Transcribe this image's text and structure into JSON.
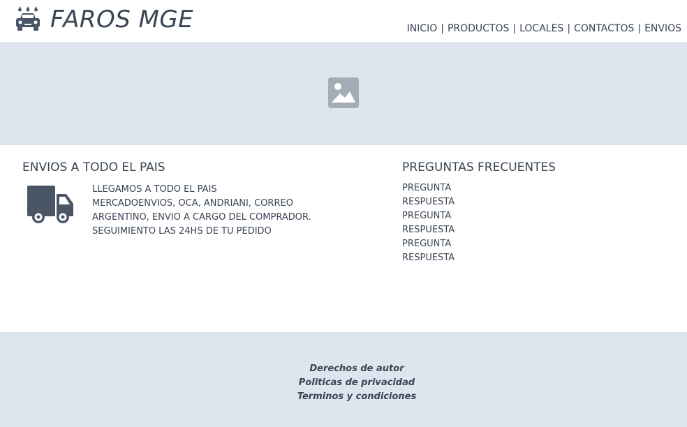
{
  "header": {
    "brand": "FAROS MGE",
    "logo_icon": "car-wash-icon",
    "nav": [
      "INICIO",
      "PRODUCTOS",
      "LOCALES",
      "CONTACTOS",
      "ENVIOS"
    ],
    "nav_separator": "|"
  },
  "banner": {
    "icon": "image-placeholder-icon",
    "background": "#dfe5ee"
  },
  "shipping": {
    "title": "ENVIOS A TODO EL PAIS",
    "icon": "truck-icon",
    "lines": [
      "LLEGAMOS A TODO EL PAIS",
      "MERCADOENVIOS, OCA, ANDRIANI, CORREO",
      "ARGENTINO, ENVIO A CARGO DEL COMPRADOR.",
      "SEGUIMIENTO LAS 24HS DE TU PEDIDO"
    ]
  },
  "faq": {
    "title": "PREGUNTAS FRECUENTES",
    "items": [
      "PREGUNTA",
      "RESPUESTA",
      "PREGUNTA",
      "RESPUESTA",
      "PREGUNTA",
      "RESPUESTA"
    ]
  },
  "footer": {
    "links": [
      "Derechos de autor",
      "Politicas de privacidad",
      "Terminos y condiciones"
    ]
  },
  "colors": {
    "text": "#3a4554",
    "panel": "#dfe5ee",
    "icon_gray": "#a3adb8"
  }
}
